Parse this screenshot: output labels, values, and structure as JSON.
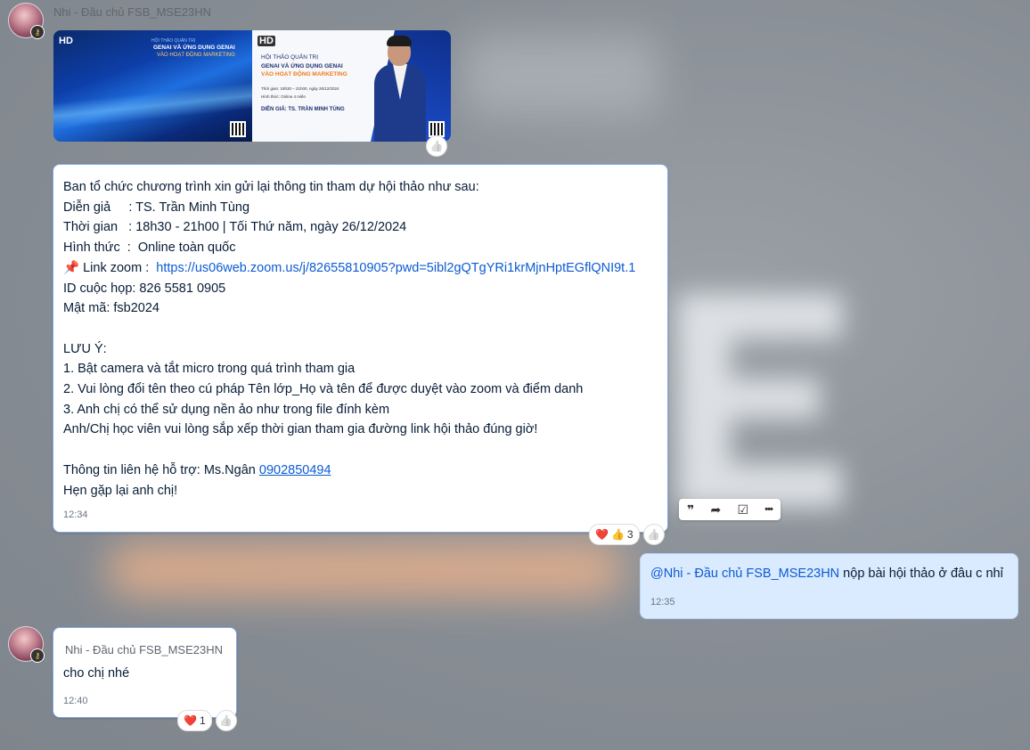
{
  "chat": {
    "sender": "Nhi - Đầu chủ FSB_MSE23HN",
    "images": {
      "img1": {
        "badge": "HD",
        "tag": "HỘI THẢO QUẢN TRỊ",
        "line1": "GENAI VÀ ỨNG DỤNG GENAI",
        "line2": "VÀO HOẠT ĐỘNG MARKETING"
      },
      "img2": {
        "badge": "HD",
        "line0": "HỘI THẢO QUẢN TRỊ",
        "line1": "GENAI VÀ ỨNG DỤNG GENAI",
        "line2": "VÀO HOẠT ĐỘNG MARKETING",
        "time": "Thời gian: 18h30 – 21h00, ngày 26/12/2024",
        "format": "Hình thức: Online 4 miền",
        "speaker": "DIỄN GIẢ: TS. TRẦN MINH TÙNG"
      }
    },
    "message1": {
      "intro": "Ban tổ chức chương trình xin gửi lại thông tin tham dự hội thảo như sau:",
      "speaker": "Diễn giả     : TS. Trần Minh Tùng",
      "time_info": "Thời gian   : 18h30 - 21h00 | Tối Thứ năm, ngày 26/12/2024",
      "format": "Hình thức  :  Online toàn quốc",
      "pin_icon": "📌",
      "zoom_label": " Link zoom :  ",
      "zoom_url": "https://us06web.zoom.us/j/82655810905?pwd=5ibl2gQTgYRi1krMjnHptEGflQNI9t.1",
      "meeting_id": "ID cuộc họp: 826 5581 0905",
      "password": "Mật mã: fsb2024",
      "note_title": "LƯU Ý:",
      "note1": "1. Bật camera và tắt micro trong quá trình tham gia",
      "note2": "2. Vui lòng đổi tên theo cú pháp Tên lớp_Họ và tên để được duyệt vào zoom và điểm danh",
      "note3": "3. Anh chị có thể sử dụng nền ảo như trong file đính kèm",
      "note4": "Anh/Chị học viên vui lòng sắp xếp thời gian tham gia đường link hội thảo đúng giờ!",
      "contact_label": "Thông tin liên hệ hỗ trợ: Ms.Ngân ",
      "contact_phone": "0902850494",
      "closing": "Hẹn gặp lại anh chị!",
      "time": "12:34",
      "reactions": {
        "heart": "❤️",
        "thumb": "👍",
        "count": "3"
      }
    },
    "toolbar": {
      "quote": "❞",
      "forward": "➦",
      "task": "☑",
      "more": "•••"
    },
    "my_message": {
      "mention": "@Nhi - Đầu chủ FSB_MSE23HN",
      "text": " nộp bài hội thảo ở đâu c nhỉ",
      "time": "12:35"
    },
    "reply": {
      "sender": "Nhi - Đầu chủ FSB_MSE23HN",
      "text": "cho chị nhé",
      "time": "12:40",
      "reactions": {
        "heart": "❤️",
        "count": "1"
      }
    },
    "like_icon": "👍"
  }
}
